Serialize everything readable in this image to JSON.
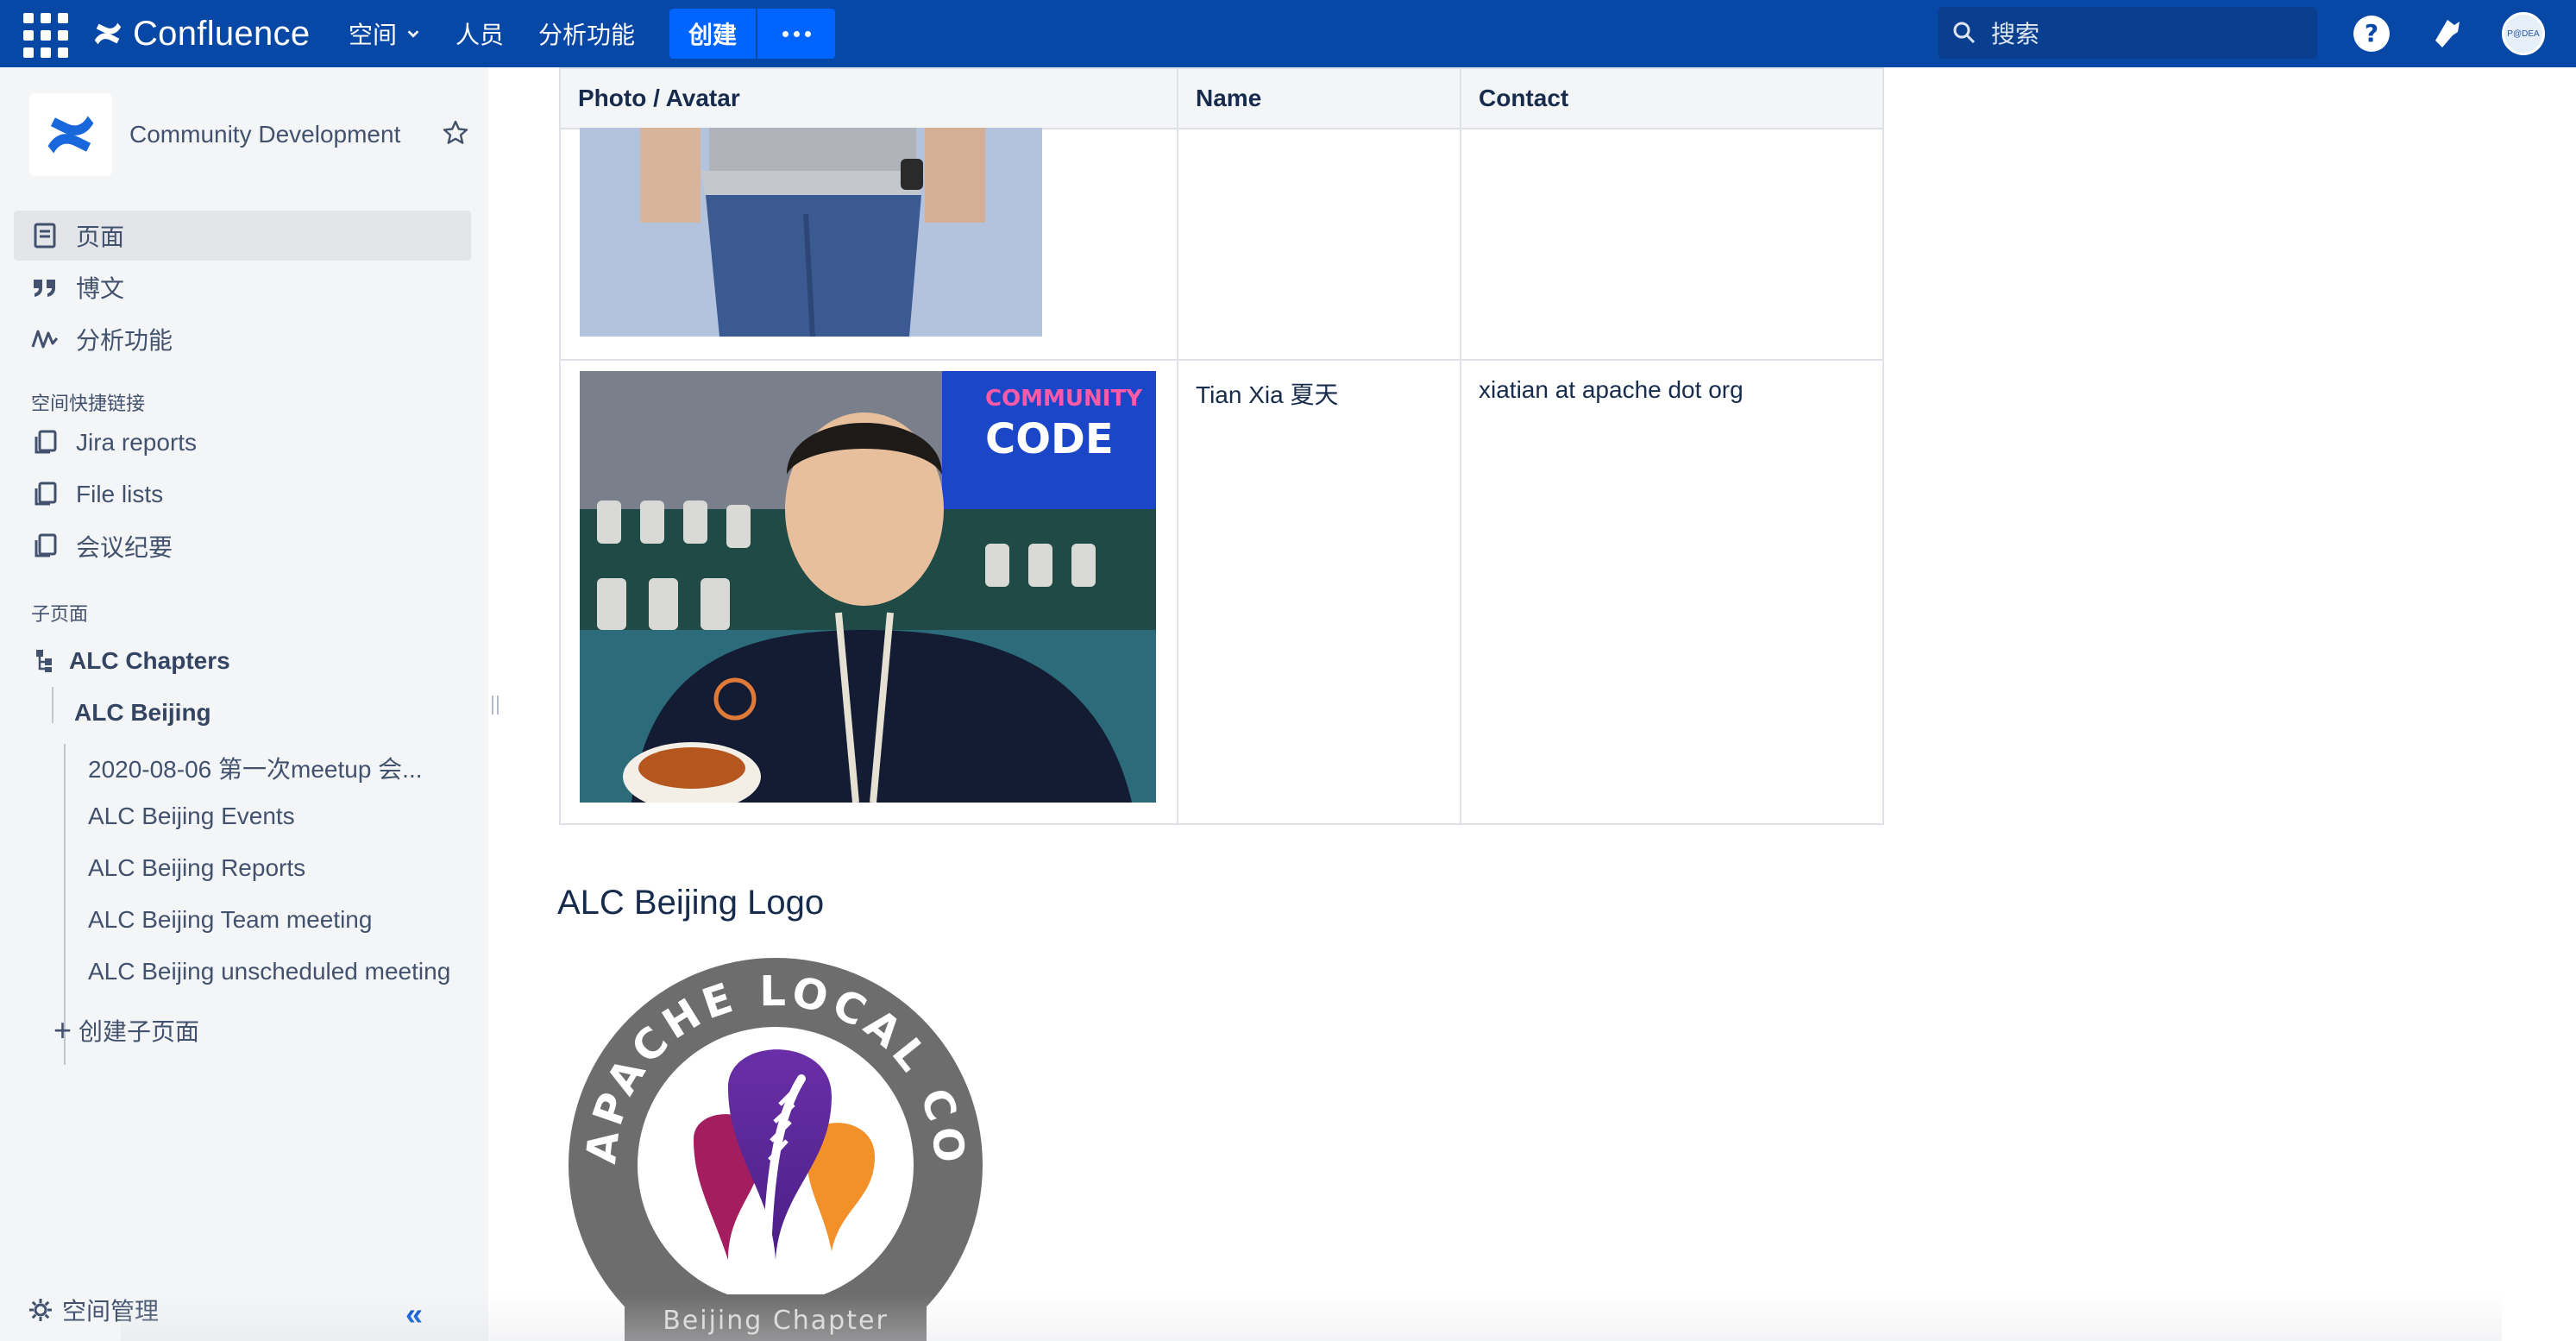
{
  "topnav": {
    "brand": "Confluence",
    "spaces_label": "空间",
    "people_label": "人员",
    "analytics_label": "分析功能",
    "create_label": "创建",
    "search_placeholder": "搜索",
    "avatar_text": "P@DEA"
  },
  "sidebar": {
    "space_name": "Community Development",
    "nav": [
      {
        "label": "页面",
        "icon": "page-icon"
      },
      {
        "label": "博文",
        "icon": "quote-icon"
      },
      {
        "label": "分析功能",
        "icon": "analytics-icon"
      }
    ],
    "shortcuts_title": "空间快捷链接",
    "shortcuts": [
      {
        "label": "Jira reports",
        "icon": "link-copy-icon"
      },
      {
        "label": "File lists",
        "icon": "link-copy-icon"
      },
      {
        "label": "会议纪要",
        "icon": "link-copy-icon"
      }
    ],
    "children_title": "子页面",
    "tree": {
      "root": "ALC Chapters",
      "level1": "ALC Beijing",
      "level2": [
        "2020-08-06 第一次meetup 会...",
        "ALC Beijing Events",
        "ALC Beijing Reports",
        "ALC Beijing Team meeting",
        "ALC Beijing unscheduled meeting"
      ]
    },
    "create_child": "创建子页面",
    "space_admin": "空间管理"
  },
  "table": {
    "headers": [
      "Photo / Avatar",
      "Name",
      "Contact"
    ],
    "rows": [
      {
        "name": "",
        "contact": ""
      },
      {
        "name": "Tian Xia 夏天",
        "contact": "xiatian at apache dot org"
      }
    ]
  },
  "logo_section": {
    "heading": "ALC Beijing Logo",
    "logo_ring_text": "APACHE LOCAL COMMUNITY",
    "logo_banner_text": "Beijing Chapter"
  },
  "colors": {
    "nav_bg": "#0747a6",
    "create_btn": "#0065ff",
    "sidebar_bg": "#f4f5f7"
  }
}
